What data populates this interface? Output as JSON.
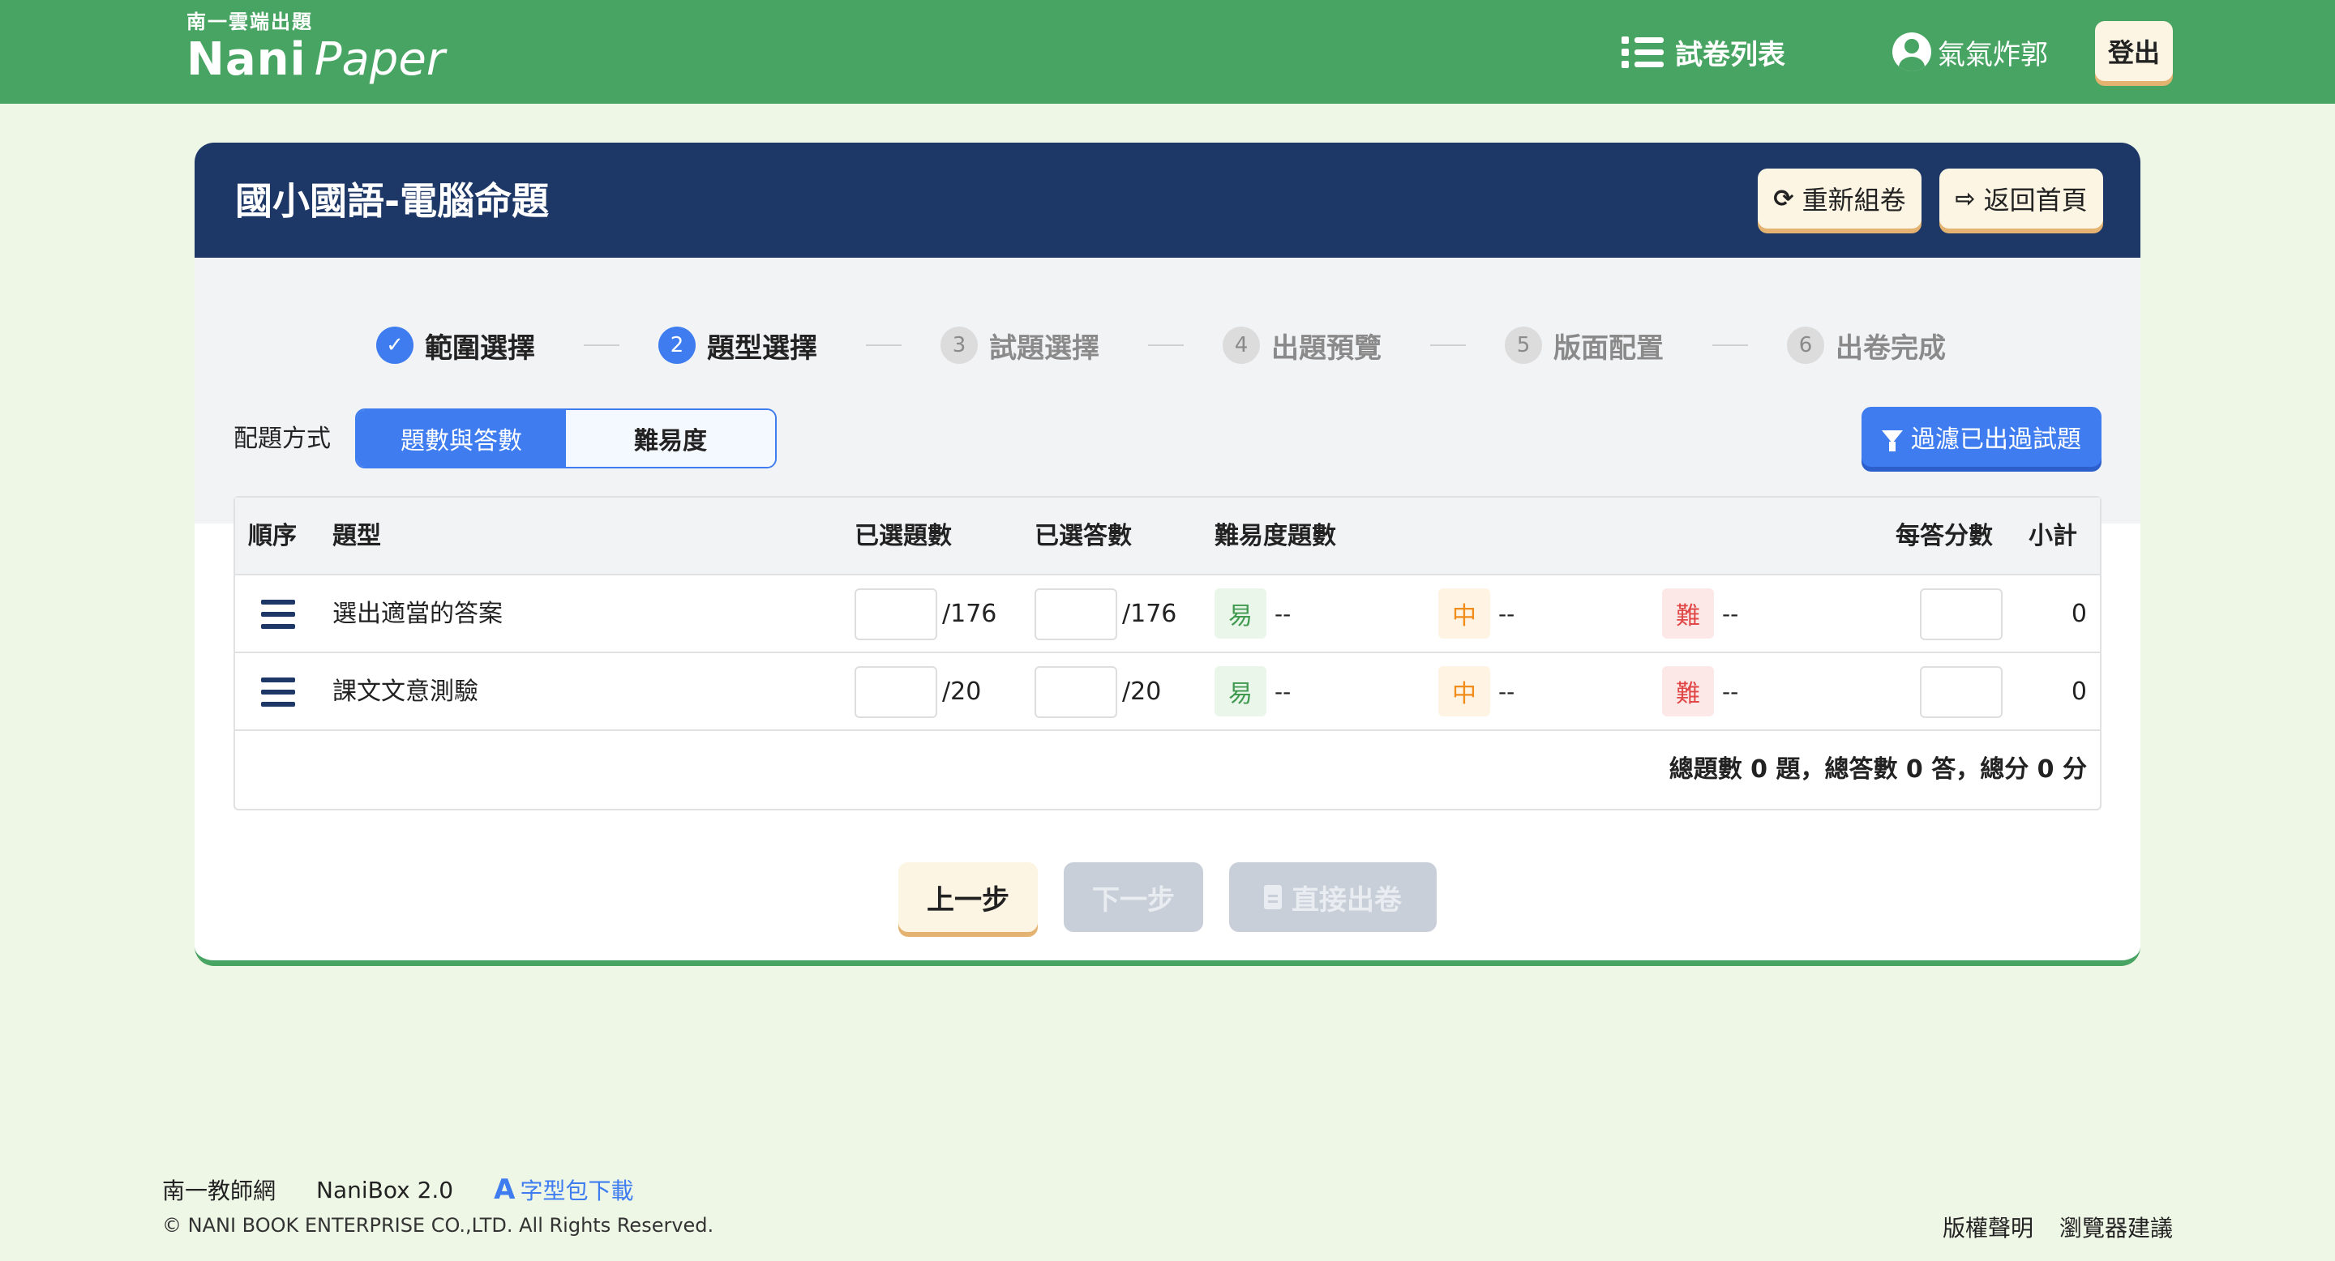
{
  "header": {
    "brand_sub": "南一雲端出題",
    "brand_main": "Nani",
    "brand_paper": "Paper",
    "nav_list_label": "試卷列表",
    "user_name": "氣氣炸郭",
    "logout_label": "登出",
    "icons": {
      "list": "list-icon",
      "user": "user-circle-icon"
    }
  },
  "card": {
    "title": "國小國語-電腦命題",
    "reset_label": "重新組卷",
    "home_label": "返回首頁",
    "icons": {
      "reset": "refresh-icon",
      "home": "sign-out-icon"
    }
  },
  "steps": [
    {
      "num": "",
      "label": "範圍選擇",
      "state": "done"
    },
    {
      "num": "2",
      "label": "題型選擇",
      "state": "active"
    },
    {
      "num": "3",
      "label": "試題選擇",
      "state": "pending"
    },
    {
      "num": "4",
      "label": "出題預覽",
      "state": "pending"
    },
    {
      "num": "5",
      "label": "版面配置",
      "state": "pending"
    },
    {
      "num": "6",
      "label": "出卷完成",
      "state": "pending"
    }
  ],
  "config": {
    "label": "配題方式",
    "modes": [
      "題數與答數",
      "難易度"
    ],
    "selected_mode": "題數與答數",
    "filter_label": "過濾已出過試題"
  },
  "table": {
    "headers": {
      "order": "順序",
      "type": "題型",
      "selected_questions": "已選題數",
      "selected_answers": "已選答數",
      "difficulty": "難易度題數",
      "score_per_answer": "每答分數",
      "subtotal": "小計"
    },
    "rows": [
      {
        "type": "選出適當的答案",
        "q_value": "",
        "q_max": "/176",
        "a_value": "",
        "a_max": "/176",
        "easy": "易",
        "easy_val": "--",
        "mid": "中",
        "mid_val": "--",
        "hard": "難",
        "hard_val": "--",
        "score": "",
        "subtotal": "0"
      },
      {
        "type": "課文文意測驗",
        "q_value": "",
        "q_max": "/20",
        "a_value": "",
        "a_max": "/20",
        "easy": "易",
        "easy_val": "--",
        "mid": "中",
        "mid_val": "--",
        "hard": "難",
        "hard_val": "--",
        "score": "",
        "subtotal": "0"
      }
    ],
    "summary": "總題數 0 題，總答數 0 答，總分 0 分"
  },
  "actions": {
    "prev_label": "上一步",
    "next_label": "下一步",
    "direct_label": "直接出卷"
  },
  "footer": {
    "link_teacher": "南一教師網",
    "link_nanibox": "NaniBox 2.0",
    "font_glyph": "A",
    "font_download": "字型包下載",
    "copyright": "© NANI BOOK ENTERPRISE CO.,LTD. All Rights Reserved.",
    "copyright_notice": "版權聲明",
    "browser_advice": "瀏覽器建議"
  },
  "colors": {
    "header_green": "#48a462",
    "page_bg": "#eef7e6",
    "card_navy": "#1d3766",
    "accent_blue": "#3e7cf0",
    "cream_button": "#fdf5e3",
    "disabled_gray": "#c9cfd8"
  }
}
